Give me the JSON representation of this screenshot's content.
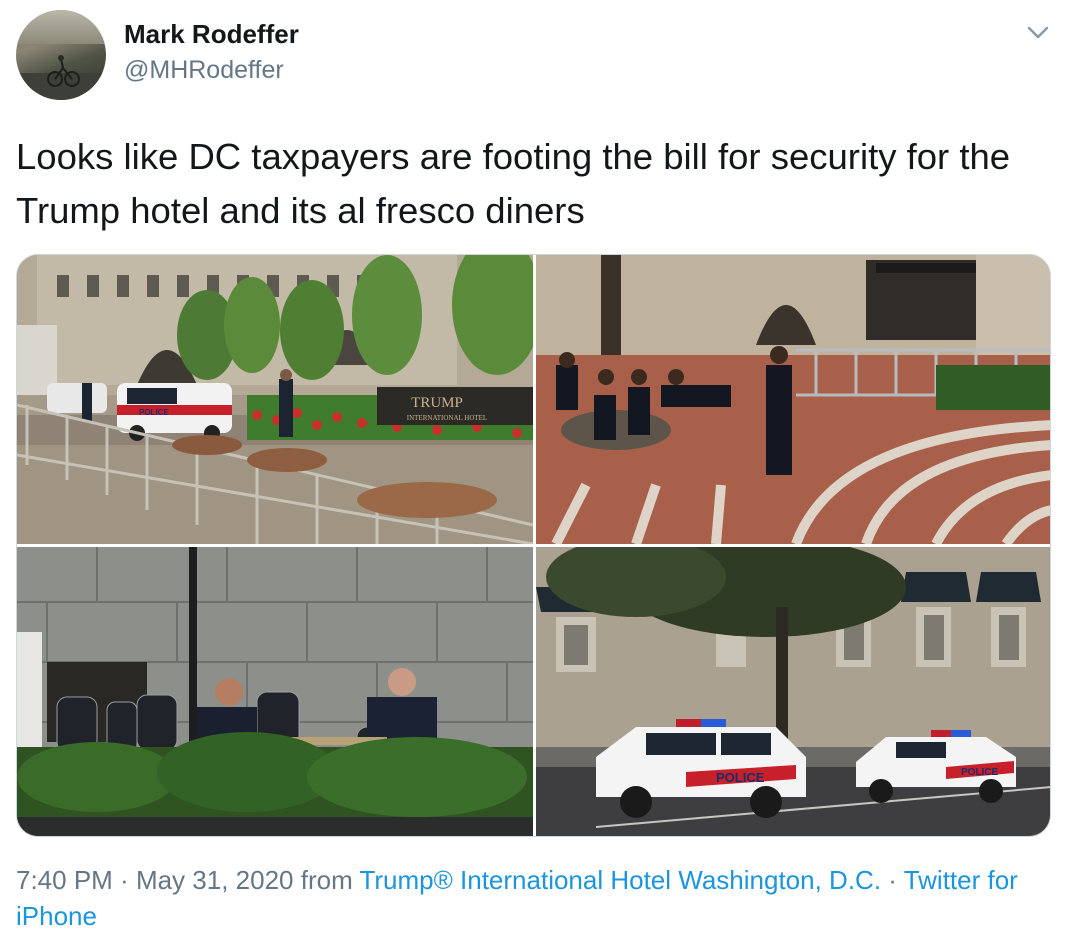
{
  "author": {
    "name": "Mark Rodeffer",
    "handle": "@MHRodeffer",
    "avatar_icon": "avatar-cyclist"
  },
  "menu_icon": "chevron-down-icon",
  "tweet": {
    "text": "Looks like DC taxpayers are footing the bill for security for the Trump hotel and its al fresco diners"
  },
  "media": {
    "photo_count": 4,
    "sign_text": "TRUMP",
    "sign_subtext": "INTERNATIONAL HOTEL",
    "police_label": "POLICE"
  },
  "footer": {
    "time": "7:40 PM",
    "separator": " · ",
    "date": "May 31, 2020",
    "from_label": " from ",
    "location": "Trump® International Hotel Washington, D.C.",
    "source": "Twitter for iPhone"
  },
  "colors": {
    "link": "#1b95e0",
    "secondary_text": "#657786",
    "primary_text": "#14171a",
    "border": "#ccd6dd"
  }
}
